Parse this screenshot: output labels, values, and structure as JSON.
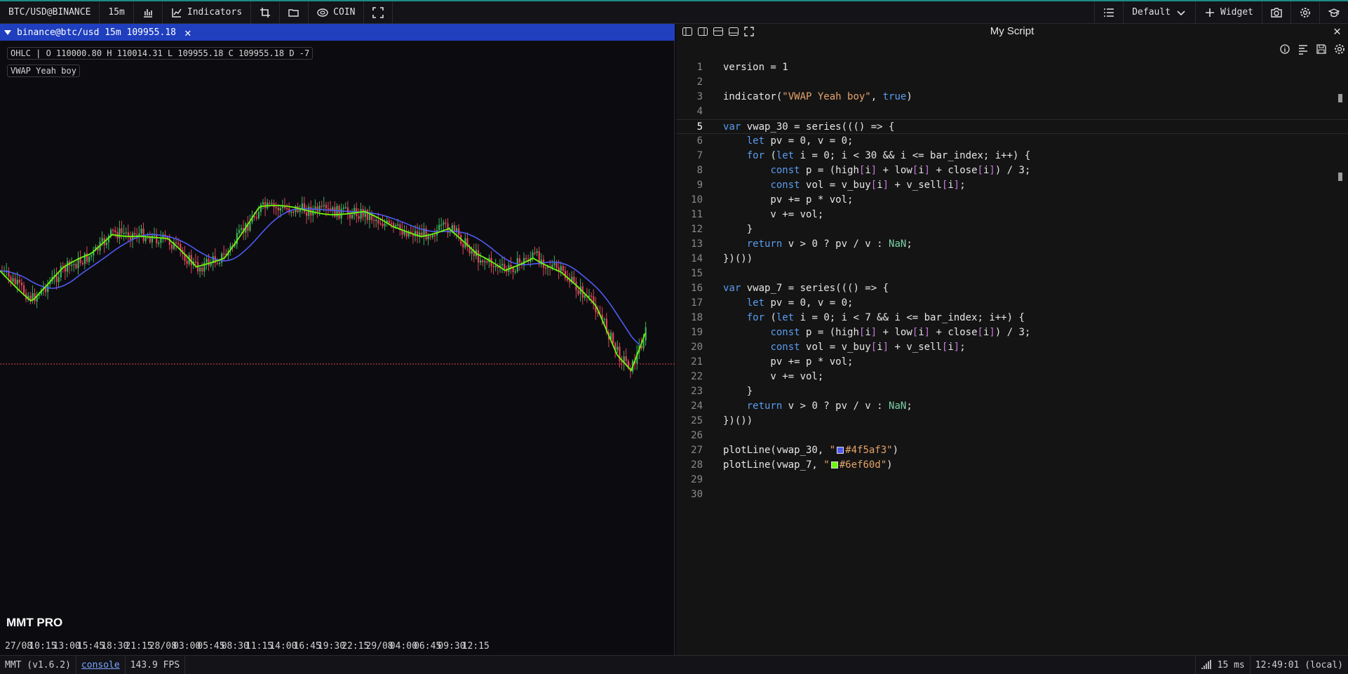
{
  "toolbar": {
    "symbol": "BTC/USD@BINANCE",
    "interval": "15m",
    "indicators_label": "Indicators",
    "coin_label": "COIN",
    "layout_label": "Default",
    "widget_label": "Widget"
  },
  "chart": {
    "tab_label": "binance@btc/usd 15m 109955.18",
    "ohlc_line": "OHLC | O 110000.80 H 110014.31 L 109955.18 C 109955.18 D -7",
    "indicator_name": "VWAP Yeah boy",
    "brand": "MMT PRO",
    "time_labels": [
      "27/08",
      "10:15",
      "13:00",
      "15:45",
      "18:30",
      "21:15",
      "28/08",
      "03:00",
      "05:45",
      "08:30",
      "11:15",
      "14:00",
      "16:45",
      "19:30",
      "22:15",
      "29/08",
      "04:00",
      "06:45",
      "09:30",
      "12:15"
    ],
    "colors": {
      "up": "#3fae5a",
      "down": "#e0435a",
      "vwap_30": "#4f5af3",
      "vwap_7": "#6ef60d",
      "price_line": "#e0435a"
    }
  },
  "script": {
    "title": "My Script",
    "current_line": 5,
    "lines": [
      "version = 1",
      "",
      "indicator(\"VWAP Yeah boy\", true)",
      "",
      "var vwap_30 = series((() => {",
      "    let pv = 0, v = 0;",
      "    for (let i = 0; i < 30 && i <= bar_index; i++) {",
      "        const p = (high[i] + low[i] + close[i]) / 3;",
      "        const vol = v_buy[i] + v_sell[i];",
      "        pv += p * vol;",
      "        v += vol;",
      "    }",
      "    return v > 0 ? pv / v : NaN;",
      "})())",
      "",
      "var vwap_7 = series((() => {",
      "    let pv = 0, v = 0;",
      "    for (let i = 0; i < 7 && i <= bar_index; i++) {",
      "        const p = (high[i] + low[i] + close[i]) / 3;",
      "        const vol = v_buy[i] + v_sell[i];",
      "        pv += p * vol;",
      "        v += vol;",
      "    }",
      "    return v > 0 ? pv / v : NaN;",
      "})())",
      "",
      "plotLine(vwap_30, \"#4f5af3\")",
      "plotLine(vwap_7, \"#6ef60d\")",
      "",
      ""
    ]
  },
  "status": {
    "version": "MMT (v1.6.2)",
    "console_label": "console",
    "fps": "143.9 FPS",
    "latency": "15 ms",
    "clock": "12:49:01 (local)"
  }
}
